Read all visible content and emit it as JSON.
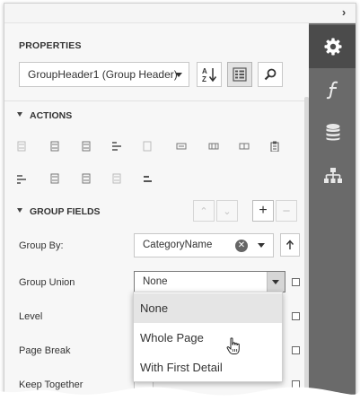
{
  "panel": {
    "title": "PROPERTIES",
    "collapse_icon": "chevron-right-icon",
    "selector": {
      "value": "GroupHeader1 (Group Header)"
    },
    "toolbar": [
      {
        "icon": "sort-alphabetical-icon"
      },
      {
        "icon": "categorized-view-icon",
        "active": true
      },
      {
        "icon": "search-icon"
      }
    ]
  },
  "tabs": [
    {
      "icon": "gear-icon",
      "active": true
    },
    {
      "icon": "function-icon"
    },
    {
      "icon": "database-icon"
    },
    {
      "icon": "hierarchy-icon"
    }
  ],
  "actions": {
    "label": "ACTIONS",
    "row1": [
      "align-left-icon",
      "align-center-icon",
      "align-right-icon",
      "align-top-icon",
      "align-middle-icon",
      "align-bottom-icon",
      "distribute-h-icon",
      "distribute-v-icon",
      "paste-icon"
    ],
    "row2": [
      "size-width-icon",
      "size-height-icon",
      "size-both-icon",
      "spacing-icon",
      "bring-front-icon"
    ]
  },
  "group_fields": {
    "label": "GROUP FIELDS",
    "group_by": {
      "label": "Group By:",
      "value": "CategoryName"
    },
    "group_union": {
      "label": "Group Union",
      "value": "None"
    },
    "level": {
      "label": "Level"
    },
    "page_break": {
      "label": "Page Break"
    },
    "keep_together": {
      "label": "Keep Together"
    }
  },
  "dropdown": {
    "options": [
      "None",
      "Whole Page",
      "With First Detail"
    ],
    "selected": "None"
  },
  "colors": {
    "sidebar": "#6a6a6a",
    "sidebar_active": "#4b4b4b",
    "panel_bg": "#f7f7f7"
  }
}
